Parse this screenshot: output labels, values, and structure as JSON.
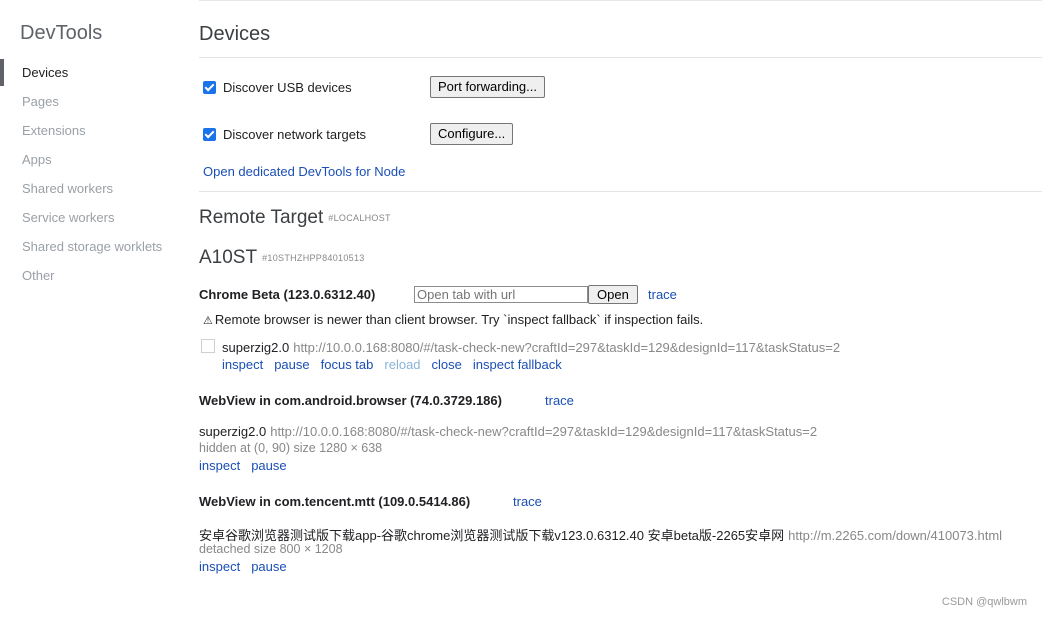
{
  "sidebar": {
    "title": "DevTools",
    "items": [
      {
        "label": "Devices"
      },
      {
        "label": "Pages"
      },
      {
        "label": "Extensions"
      },
      {
        "label": "Apps"
      },
      {
        "label": "Shared workers"
      },
      {
        "label": "Service workers"
      },
      {
        "label": "Shared storage worklets"
      },
      {
        "label": "Other"
      }
    ]
  },
  "main": {
    "title": "Devices",
    "discover_usb": {
      "label": "Discover USB devices",
      "checked": true,
      "button": "Port forwarding..."
    },
    "discover_network": {
      "label": "Discover network targets",
      "checked": true,
      "button": "Configure..."
    },
    "node_link": "Open dedicated DevTools for Node",
    "remote_target": {
      "title": "Remote Target",
      "tag": "#LOCALHOST"
    },
    "device": {
      "name": "A10ST",
      "serial": "#10STHZHPP84010513"
    },
    "browsers": [
      {
        "name": "Chrome Beta (123.0.6312.40)",
        "trace": "trace",
        "url_placeholder": "Open tab with url",
        "open_button": "Open",
        "warning": "Remote browser is newer than client browser. Try `inspect fallback` if inspection fails.",
        "target": {
          "title": "superzig2.0",
          "url": "http://10.0.0.168:8080/#/task-check-new?craftId=297&taskId=129&designId=117&taskStatus=2",
          "actions": [
            "inspect",
            "pause",
            "focus tab",
            "reload",
            "close",
            "inspect fallback"
          ]
        }
      },
      {
        "name": "WebView in com.android.browser (74.0.3729.186)",
        "trace": "trace",
        "target": {
          "title": "superzig2.0",
          "url": "http://10.0.0.168:8080/#/task-check-new?craftId=297&taskId=129&designId=117&taskStatus=2",
          "meta": "hidden  at (0, 90)  size 1280 × 638",
          "actions": [
            "inspect",
            "pause"
          ]
        }
      },
      {
        "name": "WebView in com.tencent.mtt (109.0.5414.86)",
        "trace": "trace",
        "target": {
          "title": "安卓谷歌浏览器测试版下载app-谷歌chrome浏览器测试版下载v123.0.6312.40 安卓beta版-2265安卓网",
          "url": "http://m.2265.com/down/410073.html",
          "meta": "detached  size 800 × 1208",
          "actions": [
            "inspect",
            "pause"
          ]
        }
      }
    ]
  },
  "watermark": "CSDN @qwlbwm",
  "colors": {
    "link": "#1a4fb4",
    "checkbox": "#1a73e8",
    "active_indicator": "#5f6368"
  }
}
